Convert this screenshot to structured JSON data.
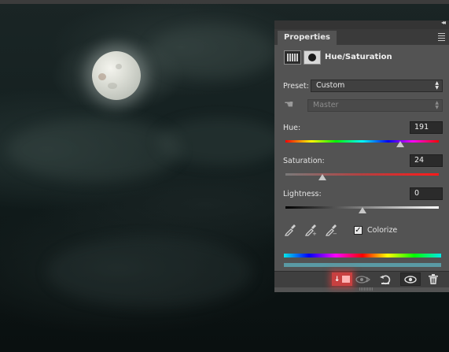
{
  "panel": {
    "tab_label": "Properties",
    "adjustment_title": "Hue/Saturation",
    "preset_label": "Preset:",
    "preset_value": "Custom",
    "channel_value": "Master",
    "hue": {
      "label": "Hue:",
      "value": "191",
      "level": 0.75
    },
    "saturation": {
      "label": "Saturation:",
      "value": "24",
      "level": 0.24
    },
    "lightness": {
      "label": "Lightness:",
      "value": "0",
      "level": 0.5
    },
    "colorize_label": "Colorize",
    "colorize_checked": true
  },
  "icons": {
    "collapse": "double-chevron-right-icon",
    "menu": "panel-menu-icon",
    "adjustment": "hue-saturation-adjustment-icon",
    "mask": "layer-mask-icon",
    "hand": "targeted-adjustment-hand-icon",
    "eyedropper": "eyedropper-icon",
    "eyedropper_add": "eyedropper-add-icon",
    "eyedropper_subtract": "eyedropper-subtract-icon",
    "clip": "clip-to-layer-icon",
    "view_previous": "view-previous-state-icon",
    "reset": "reset-icon",
    "visibility": "eye-icon",
    "delete": "trash-icon"
  },
  "colors": {
    "panel_bg": "#535353",
    "accent_clip": "#c84040",
    "spectrum_result": "#5a9aa4"
  }
}
